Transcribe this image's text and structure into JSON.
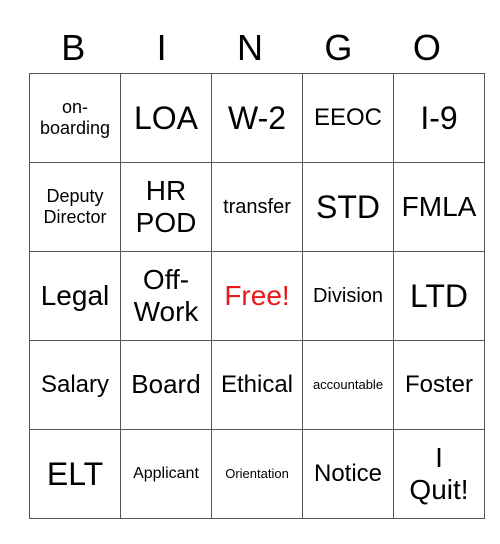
{
  "header": [
    "B",
    "I",
    "N",
    "G",
    "O"
  ],
  "free_color": "#e8191a",
  "rows": [
    [
      {
        "t": "on-\nboarding",
        "s": 18
      },
      {
        "t": "LOA",
        "s": 32
      },
      {
        "t": "W-2",
        "s": 32
      },
      {
        "t": "EEOC",
        "s": 24
      },
      {
        "t": "I-9",
        "s": 32
      }
    ],
    [
      {
        "t": "Deputy\nDirector",
        "s": 18
      },
      {
        "t": "HR\nPOD",
        "s": 28
      },
      {
        "t": "transfer",
        "s": 20
      },
      {
        "t": "STD",
        "s": 32
      },
      {
        "t": "FMLA",
        "s": 28
      }
    ],
    [
      {
        "t": "Legal",
        "s": 28
      },
      {
        "t": "Off-\nWork",
        "s": 28
      },
      {
        "t": "Free!",
        "s": 28,
        "free": true
      },
      {
        "t": "Division",
        "s": 20
      },
      {
        "t": "LTD",
        "s": 32
      }
    ],
    [
      {
        "t": "Salary",
        "s": 24
      },
      {
        "t": "Board",
        "s": 26
      },
      {
        "t": "Ethical",
        "s": 24
      },
      {
        "t": "accountable",
        "s": 13
      },
      {
        "t": "Foster",
        "s": 24
      }
    ],
    [
      {
        "t": "ELT",
        "s": 32
      },
      {
        "t": "Applicant",
        "s": 16
      },
      {
        "t": "Orientation",
        "s": 13
      },
      {
        "t": "Notice",
        "s": 24
      },
      {
        "t": "I\nQuit!",
        "s": 28
      }
    ]
  ]
}
